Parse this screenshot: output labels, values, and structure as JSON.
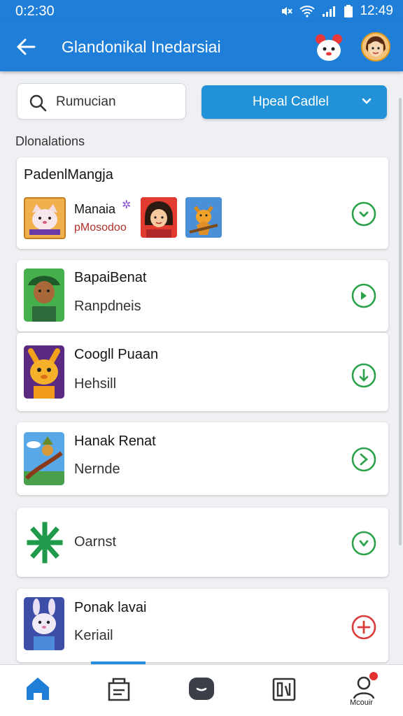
{
  "status_bar": {
    "time": "0:2:30",
    "clock": "12:49"
  },
  "app_bar": {
    "title": "Glandonikal Inedarsiai"
  },
  "search": {
    "value": "Rumucian"
  },
  "dropdown": {
    "label": "Hpeal Cadlel"
  },
  "section": {
    "label": "Dlonalations"
  },
  "featured_card": {
    "header": "PadenlMangja",
    "item_title": "Manaia",
    "item_subtitle": "pMosodoo"
  },
  "list_items": [
    {
      "title": "BapaiBenat",
      "subtitle": "Ranpdneis",
      "action": "download"
    },
    {
      "title": "Coogll Puaan",
      "subtitle": "Hehsill",
      "action": "download"
    },
    {
      "title": "Hanak Renat",
      "subtitle": "Nernde",
      "action": "download"
    },
    {
      "title": "",
      "subtitle": "Oarnst",
      "action": "download"
    },
    {
      "title": "Ponak lavai",
      "subtitle": "Keriail",
      "action": "add"
    }
  ],
  "bottom_nav": {
    "profile_label": "Mcouir"
  },
  "colors": {
    "primary": "#1f7fd8",
    "button": "#2192d8",
    "download": "#2ca24a",
    "add": "#d93a3a"
  },
  "icons": [
    "back-arrow-icon",
    "search-icon",
    "chevron-down-icon",
    "download-icon",
    "add-icon",
    "home-icon",
    "store-icon",
    "chat-icon",
    "library-icon",
    "profile-icon"
  ]
}
